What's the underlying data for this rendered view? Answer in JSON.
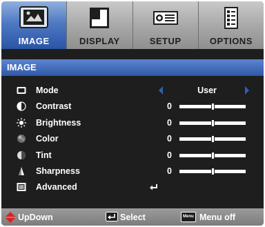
{
  "tabs": [
    {
      "label": "IMAGE",
      "icon": "picture-icon",
      "active": true
    },
    {
      "label": "DISPLAY",
      "icon": "display-icon",
      "active": false
    },
    {
      "label": "SETUP",
      "icon": "projector-icon",
      "active": false
    },
    {
      "label": "OPTIONS",
      "icon": "options-icon",
      "active": false
    }
  ],
  "section": {
    "title": "IMAGE"
  },
  "rows": [
    {
      "label": "Mode",
      "icon": "mode-icon",
      "value": "User"
    },
    {
      "label": "Contrast",
      "icon": "contrast-icon",
      "value": "0",
      "level": 0.5
    },
    {
      "label": "Brightness",
      "icon": "brightness-icon",
      "value": "0",
      "level": 0.5
    },
    {
      "label": "Color",
      "icon": "color-icon",
      "value": "0",
      "level": 0.5
    },
    {
      "label": "Tint",
      "icon": "tint-icon",
      "value": "0",
      "level": 0.5
    },
    {
      "label": "Sharpness",
      "icon": "sharpness-icon",
      "value": "0",
      "level": 0.5
    },
    {
      "label": "Advanced",
      "icon": "advanced-icon",
      "value": "↵"
    }
  ],
  "footer": {
    "updown": "UpDown",
    "select": "Select",
    "menu_key": "Menu",
    "menu_off": "Menu off"
  },
  "colors": {
    "background": "#1e1e1e",
    "accent_blue": "#2f58a8",
    "arrow_red": "#e02020"
  }
}
